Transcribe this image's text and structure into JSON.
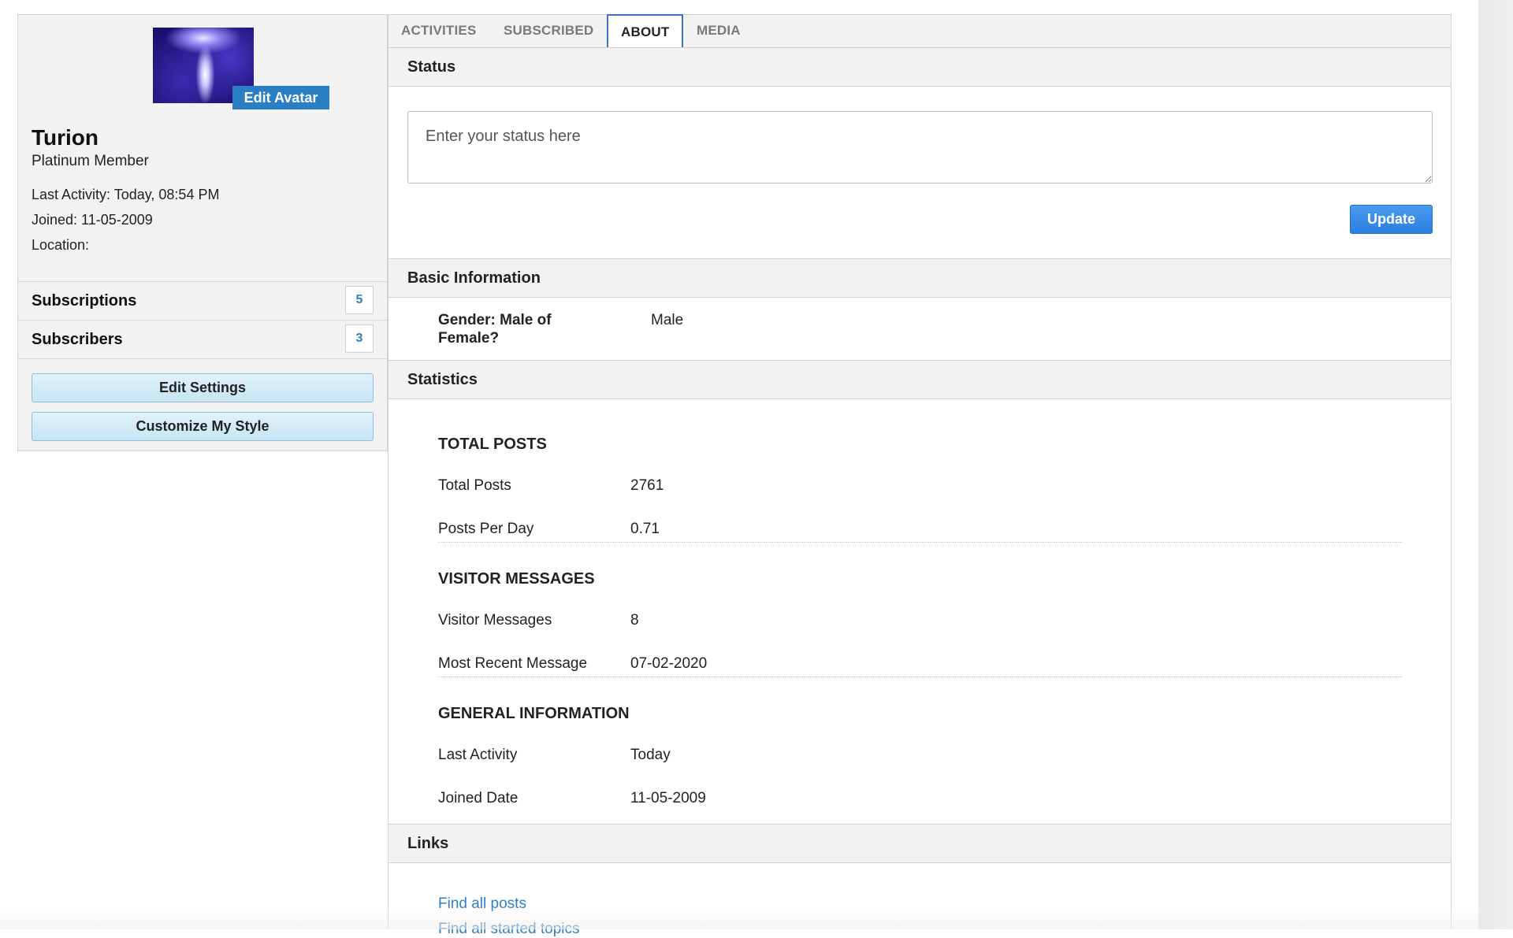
{
  "sidebar": {
    "edit_avatar_label": "Edit Avatar",
    "user_name": "Turion",
    "user_rank": "Platinum Member",
    "last_activity": "Last Activity: Today, 08:54 PM",
    "joined": "Joined: 11-05-2009",
    "location": "Location:",
    "subscriptions": {
      "label": "Subscriptions",
      "count": "5"
    },
    "subscribers": {
      "label": "Subscribers",
      "count": "3"
    },
    "edit_settings_label": "Edit Settings",
    "customize_style_label": "Customize My Style"
  },
  "tabs": [
    {
      "label": "ACTIVITIES",
      "active": false
    },
    {
      "label": "SUBSCRIBED",
      "active": false
    },
    {
      "label": "ABOUT",
      "active": true
    },
    {
      "label": "MEDIA",
      "active": false
    }
  ],
  "status": {
    "header": "Status",
    "placeholder": "Enter your status here",
    "update_label": "Update"
  },
  "basic_info": {
    "header": "Basic Information",
    "gender_label": "Gender: Male of Female?",
    "gender_value": "Male"
  },
  "statistics": {
    "header": "Statistics",
    "total_posts_title": "TOTAL POSTS",
    "total_posts_label": "Total Posts",
    "total_posts_value": "2761",
    "posts_per_day_label": "Posts Per Day",
    "posts_per_day_value": "0.71",
    "visitor_messages_title": "VISITOR MESSAGES",
    "visitor_messages_label": "Visitor Messages",
    "visitor_messages_value": "8",
    "most_recent_label": "Most Recent Message",
    "most_recent_value": "07-02-2020",
    "general_info_title": "GENERAL INFORMATION",
    "last_activity_label": "Last Activity",
    "last_activity_value": "Today",
    "joined_date_label": "Joined Date",
    "joined_date_value": "11-05-2009"
  },
  "links": {
    "header": "Links",
    "find_posts": "Find all posts",
    "find_topics": "Find all started topics"
  },
  "colors": {
    "accent_blue": "#2a7fc4",
    "update_button": "#2b7fe0",
    "link": "#2f7fc0",
    "panel_bg": "#f2f2f2",
    "settings_button": "#c6e4f3"
  }
}
